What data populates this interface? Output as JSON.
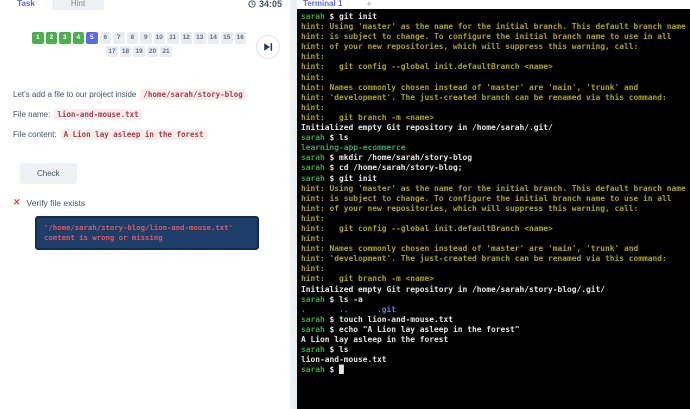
{
  "colors": {
    "accent-indigo": "#5b6be8",
    "step-done": "#4caf50",
    "step-current": "#5b6be8",
    "step-todo-bg": "#e9edf2",
    "step-todo-text": "#5f7186",
    "text-primary": "#44546a",
    "code-pink-bg": "#fcedf0",
    "code-pink-text": "#a83a4e",
    "error-red": "#dd4b39",
    "navy-box-bg": "#1d3e68",
    "navy-box-text": "#e25563"
  },
  "left_panel": {
    "tabs": [
      {
        "label": "Task",
        "active": true
      },
      {
        "label": "Hint",
        "active": false
      }
    ],
    "timer": "34:05",
    "steps": [
      {
        "label": "1",
        "state": "done"
      },
      {
        "label": "2",
        "state": "done"
      },
      {
        "label": "3",
        "state": "done"
      },
      {
        "label": "4",
        "state": "done"
      },
      {
        "label": "5",
        "state": "current"
      },
      {
        "label": "6",
        "state": "todo"
      },
      {
        "label": "7",
        "state": "todo"
      },
      {
        "label": "8",
        "state": "todo"
      },
      {
        "label": "9",
        "state": "todo"
      },
      {
        "label": "10",
        "state": "todo"
      },
      {
        "label": "11",
        "state": "todo"
      },
      {
        "label": "12",
        "state": "todo"
      },
      {
        "label": "13",
        "state": "todo"
      },
      {
        "label": "14",
        "state": "todo"
      },
      {
        "label": "15",
        "state": "todo"
      },
      {
        "label": "16",
        "state": "todo"
      },
      {
        "label": "17",
        "state": "todo"
      },
      {
        "label": "18",
        "state": "todo"
      },
      {
        "label": "19",
        "state": "todo"
      },
      {
        "label": "20",
        "state": "todo"
      },
      {
        "label": "21",
        "state": "todo"
      }
    ],
    "task": {
      "intro_text": "Let's add a file to our project inside",
      "intro_code": "/home/sarah/story-blog",
      "file_name_label": "File name:",
      "file_name_code": "lion-and-mouse.txt",
      "file_content_label": "File content:",
      "file_content_code": "A Lion lay asleep in the forest"
    },
    "check_button_label": "Check",
    "verify": {
      "icon": "✕",
      "label": "Verify file exists",
      "error_line1": "'/home/sarah/story-blog/lion-and-mouse.txt'",
      "error_line2": "content is wrong or missing"
    }
  },
  "terminal": {
    "header": {
      "title": "Terminal 1",
      "add_label": "+"
    },
    "colors": {
      "g": "#3fa33f",
      "w": "#e6e6e6",
      "y": "#a8a019",
      "t": "#38a06e",
      "b": "#4c86cc"
    },
    "lines": [
      [
        [
          "g",
          "sarah"
        ],
        [
          "w",
          " $ git init"
        ]
      ],
      [
        [
          "y",
          "hint: Using 'master' as the name for the initial branch. This default branch name"
        ]
      ],
      [
        [
          "y",
          "hint: is subject to change. To configure the initial branch name to use in all"
        ]
      ],
      [
        [
          "y",
          "hint: of your new repositories, which will suppress this warning, call:"
        ]
      ],
      [
        [
          "y",
          "hint:"
        ]
      ],
      [
        [
          "y",
          "hint:   git config --global init.defaultBranch <name>"
        ]
      ],
      [
        [
          "y",
          "hint:"
        ]
      ],
      [
        [
          "y",
          "hint: Names commonly chosen instead of 'master' are 'main', 'trunk' and"
        ]
      ],
      [
        [
          "y",
          "hint: 'development'. The just-created branch can be renamed via this command:"
        ]
      ],
      [
        [
          "y",
          "hint:"
        ]
      ],
      [
        [
          "y",
          "hint:   git branch -m <name>"
        ]
      ],
      [
        [
          "w",
          "Initialized empty Git repository in /home/sarah/.git/"
        ]
      ],
      [
        [
          "g",
          "sarah"
        ],
        [
          "w",
          " $ ls"
        ]
      ],
      [
        [
          "t",
          "learning-app-ecommerce"
        ]
      ],
      [
        [
          "g",
          "sarah"
        ],
        [
          "w",
          " $ mkdir /home/sarah/story-blog"
        ]
      ],
      [
        [
          "g",
          "sarah"
        ],
        [
          "w",
          " $ cd /home/sarah/story-blog;"
        ]
      ],
      [
        [
          "g",
          "sarah"
        ],
        [
          "w",
          " $ git init"
        ]
      ],
      [
        [
          "y",
          "hint: Using 'master' as the name for the initial branch. This default branch name"
        ]
      ],
      [
        [
          "y",
          "hint: is subject to change. To configure the initial branch name to use in all"
        ]
      ],
      [
        [
          "y",
          "hint: of your new repositories, which will suppress this warning, call:"
        ]
      ],
      [
        [
          "y",
          "hint:"
        ]
      ],
      [
        [
          "y",
          "hint:   git config --global init.defaultBranch <name>"
        ]
      ],
      [
        [
          "y",
          "hint:"
        ]
      ],
      [
        [
          "y",
          "hint: Names commonly chosen instead of 'master' are 'main', 'trunk' and"
        ]
      ],
      [
        [
          "y",
          "hint: 'development'. The just-created branch can be renamed via this command:"
        ]
      ],
      [
        [
          "y",
          "hint:"
        ]
      ],
      [
        [
          "y",
          "hint:   git branch -m <name>"
        ]
      ],
      [
        [
          "w",
          "Initialized empty Git repository in /home/sarah/story-blog/.git/"
        ]
      ],
      [
        [
          "g",
          "sarah"
        ],
        [
          "w",
          " $ ls -a"
        ]
      ],
      [
        [
          "b",
          ".       ..      .git"
        ]
      ],
      [
        [
          "g",
          "sarah"
        ],
        [
          "w",
          " $ touch lion-and-mouse.txt"
        ]
      ],
      [
        [
          "g",
          "sarah"
        ],
        [
          "w",
          " $ echo \"A Lion lay asleep in the forest\""
        ]
      ],
      [
        [
          "w",
          "A Lion lay asleep in the forest"
        ]
      ],
      [
        [
          "g",
          "sarah"
        ],
        [
          "w",
          " $ ls"
        ]
      ],
      [
        [
          "w",
          "lion-and-mouse.txt"
        ]
      ],
      [
        [
          "g",
          "sarah"
        ],
        [
          "w",
          " $ "
        ],
        [
          "w",
          "█"
        ]
      ]
    ]
  }
}
